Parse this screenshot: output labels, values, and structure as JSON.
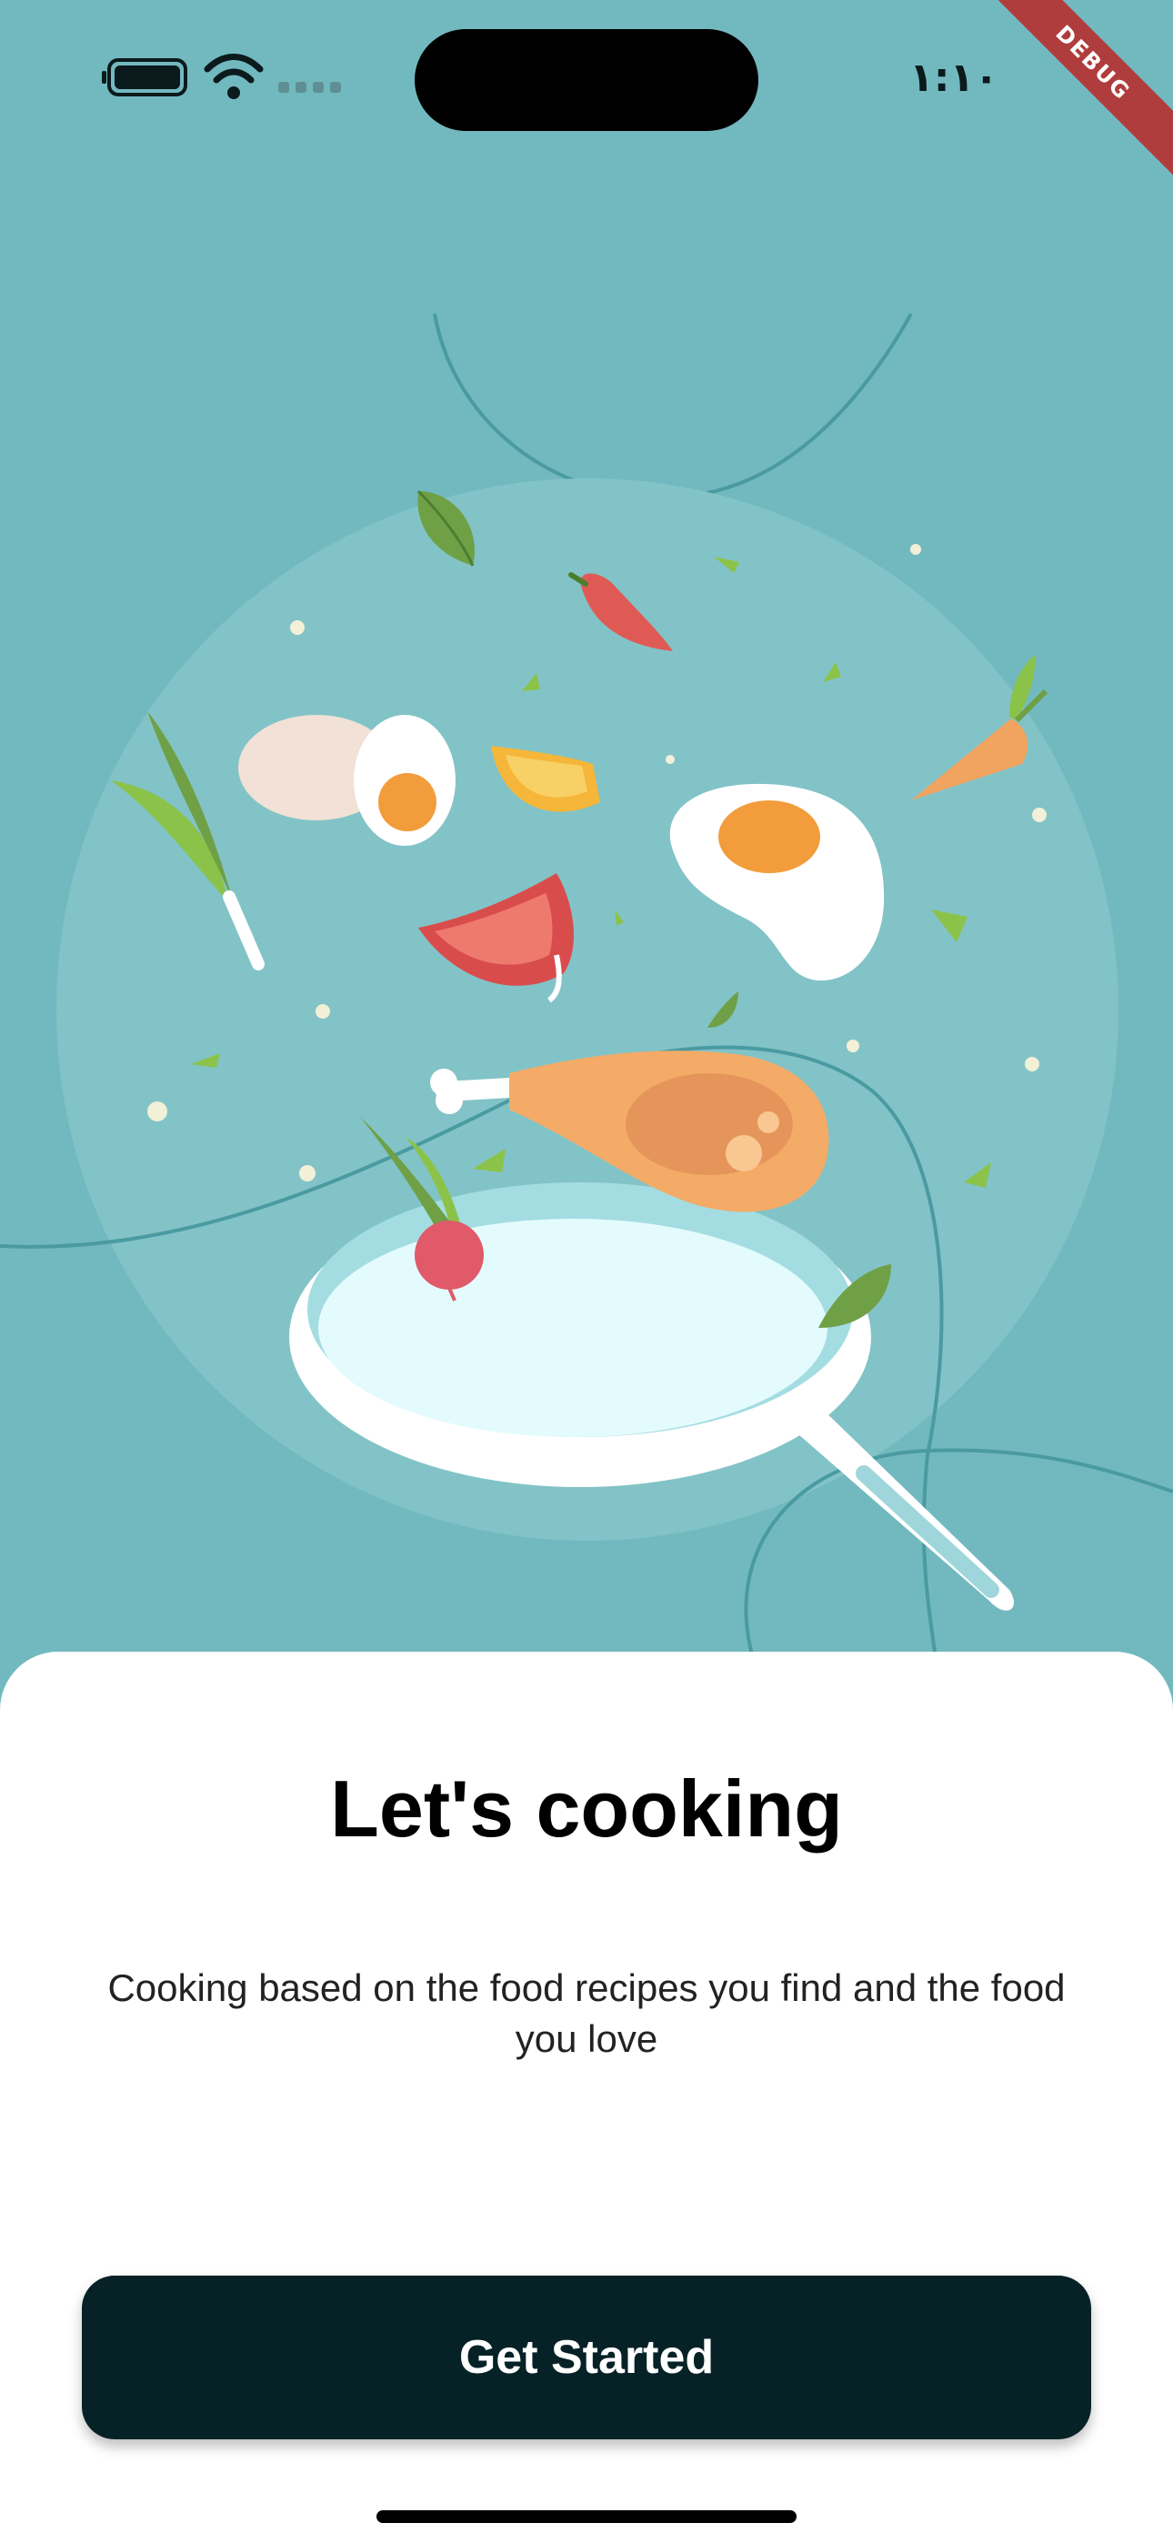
{
  "status_bar": {
    "time": "١:١٠",
    "icons": [
      "battery-icon",
      "wifi-icon",
      "cellular-signal-icon"
    ]
  },
  "debug_banner": "DEBUG",
  "illustration": {
    "icons": [
      "leaf-icon",
      "chili-pepper-icon",
      "boiled-egg-icon",
      "tomato-slice-icon",
      "carrot-icon",
      "spring-onion-icon",
      "fried-egg-icon",
      "chicken-drumstick-icon",
      "radish-icon",
      "frying-pan-icon"
    ]
  },
  "onboarding": {
    "title": "Let's cooking",
    "subtitle": "Cooking based on the food recipes you find and the food you love",
    "cta_label": "Get Started"
  },
  "colors": {
    "background": "#72b9bf",
    "button": "#062226",
    "sheet": "#ffffff"
  }
}
